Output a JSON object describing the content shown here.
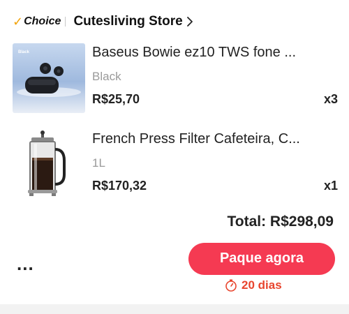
{
  "store": {
    "choice_label": "Choice",
    "name": "Cutesliving Store"
  },
  "items": [
    {
      "title": "Baseus Bowie ez10 TWS fone de ouvido",
      "display_title": "Baseus Bowie ez10 TWS fone ...",
      "variant": "Black",
      "price": "R$25,70",
      "quantity": "x3",
      "thumbnail_text": "Black"
    },
    {
      "title": "French Press Filter Cafeteira",
      "display_title": "French Press Filter Cafeteira, C...",
      "variant": "1L",
      "price": "R$170,32",
      "quantity": "x1"
    }
  ],
  "summary": {
    "total": "Total: R$298,09"
  },
  "actions": {
    "more_label": "...",
    "pay_label": "Paque agora"
  },
  "deadline": {
    "label": "20 dias"
  },
  "colors": {
    "accent": "#f53a52",
    "deadline": "#e8452e",
    "choice_check": "#f2a30a"
  },
  "icons": {
    "choice": "checkmark-icon",
    "store": "chevron-right-icon",
    "timer": "stopwatch-icon"
  }
}
